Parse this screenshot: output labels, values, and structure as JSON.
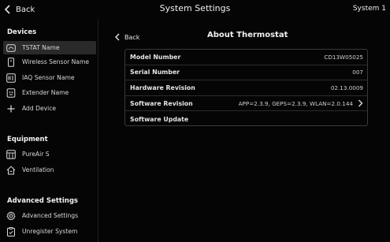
{
  "topbar": {
    "back_label": "Back",
    "title": "System Settings",
    "system_label": "System 1"
  },
  "sidebar": {
    "devices": {
      "header": "Devices",
      "items": [
        {
          "label": "TSTAT Name",
          "icon": "thermostat-icon"
        },
        {
          "label": "Wireless Sensor Name",
          "icon": "wireless-sensor-icon"
        },
        {
          "label": "IAQ Sensor Name",
          "icon": "iaq-sensor-icon"
        },
        {
          "label": "Extender Name",
          "icon": "extender-icon"
        },
        {
          "label": "Add Device",
          "icon": "plus-icon"
        }
      ]
    },
    "equipment": {
      "header": "Equipment",
      "items": [
        {
          "label": "PureAir S",
          "icon": "air-purifier-icon"
        },
        {
          "label": "Ventilation",
          "icon": "ventilation-house-icon"
        }
      ]
    },
    "advanced": {
      "header": "Advanced Settings",
      "items": [
        {
          "label": "Advanced Settings",
          "icon": "gear-icon"
        },
        {
          "label": "Unregister System",
          "icon": "clipboard-check-icon"
        }
      ]
    }
  },
  "main": {
    "back_label": "Back",
    "title": "About Thermostat",
    "rows": [
      {
        "label": "Model Number",
        "value": "CD13W05025"
      },
      {
        "label": "Serial Number",
        "value": "007"
      },
      {
        "label": "Hardware Revision",
        "value": "02.13.0009"
      },
      {
        "label": "Software Revision",
        "value": "APP=2.3.9, GEPS=2.3.9, WLAN=2.0.144"
      },
      {
        "label": "Software Update",
        "value": ""
      }
    ]
  },
  "colors": {
    "background": "#050505",
    "active_item": "#2a2a2a",
    "text": "#e8e8e8",
    "border": "#3a3a3a"
  }
}
